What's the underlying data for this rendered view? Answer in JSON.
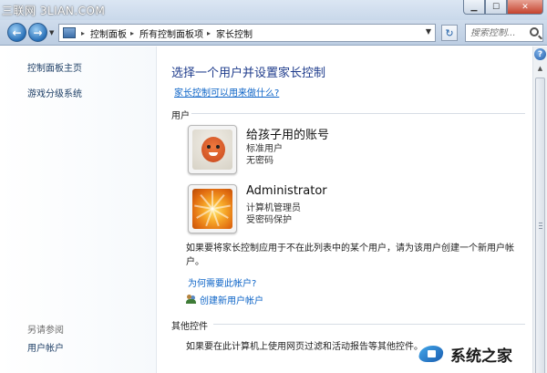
{
  "window": {
    "watermark": "三联网 3LIAN.COM",
    "minimize_icon": "minimize-icon",
    "maximize_icon": "maximize-icon",
    "close_icon": "close-icon"
  },
  "address_bar": {
    "breadcrumbs": [
      "控制面板",
      "所有控制面板项",
      "家长控制"
    ],
    "search_placeholder": "搜索控制..."
  },
  "sidebar": {
    "links": [
      "控制面板主页",
      "游戏分级系统"
    ],
    "see_also_heading": "另请参阅",
    "see_also_links": [
      "用户帐户"
    ]
  },
  "main": {
    "title": "选择一个用户并设置家长控制",
    "help_link": "家长控制可以用来做什么?",
    "users_section": "用户",
    "accounts": [
      {
        "name": "给孩子用的账号",
        "type": "标准用户",
        "password": "无密码",
        "icon": "kid-avatar"
      },
      {
        "name": "Administrator",
        "type": "计算机管理员",
        "password": "受密码保护",
        "icon": "flower-avatar"
      }
    ],
    "info_text": "如果要将家长控制应用于不在此列表中的某个用户，请为该用户创建一个新用户帐户。",
    "why_link": "为何需要此帐户?",
    "create_link": "创建新用户帐户",
    "other_section": "其他控件",
    "bottom_text": "如果要在此计算机上使用网页过滤和活动报告等其他控件。"
  },
  "brand": {
    "text": "系统之家"
  },
  "colors": {
    "title_blue": "#1f3c8c",
    "link_blue": "#0b63c7",
    "sidebar_link": "#1e3f66"
  }
}
